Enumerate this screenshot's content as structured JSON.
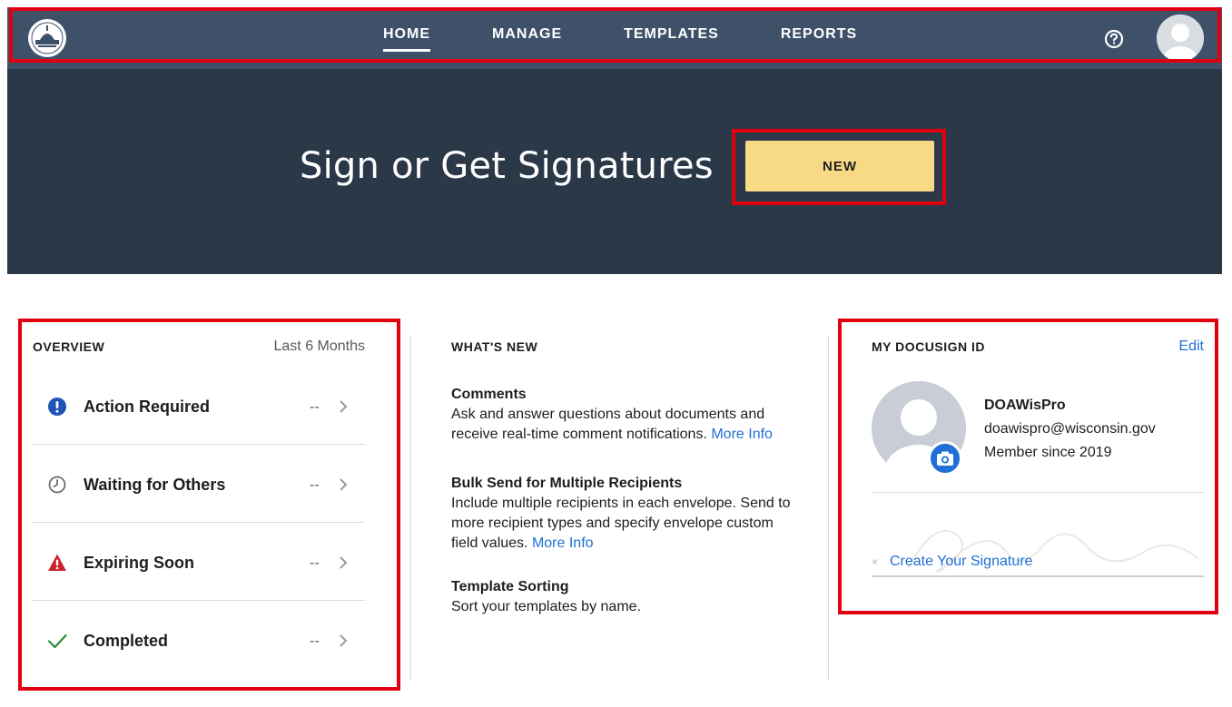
{
  "nav": {
    "tabs": [
      {
        "label": "HOME",
        "active": true
      },
      {
        "label": "MANAGE",
        "active": false
      },
      {
        "label": "TEMPLATES",
        "active": false
      },
      {
        "label": "REPORTS",
        "active": false
      }
    ],
    "help_icon": "help-circle-icon",
    "avatar_icon": "user-avatar-icon",
    "logo_icon": "state-seal-logo"
  },
  "hero": {
    "title": "Sign or Get Signatures",
    "new_button": "NEW"
  },
  "overview": {
    "title": "OVERVIEW",
    "range": "Last 6 Months",
    "rows": [
      {
        "label": "Action Required",
        "count": "--",
        "icon": "exclamation-circle-icon"
      },
      {
        "label": "Waiting for Others",
        "count": "--",
        "icon": "clock-icon"
      },
      {
        "label": "Expiring Soon",
        "count": "--",
        "icon": "warning-triangle-icon"
      },
      {
        "label": "Completed",
        "count": "--",
        "icon": "checkmark-icon"
      }
    ]
  },
  "whats_new": {
    "title": "WHAT'S NEW",
    "items": [
      {
        "title": "Comments",
        "body": "Ask and answer questions about documents and receive real-time comment notifications.",
        "link": "More Info"
      },
      {
        "title": "Bulk Send for Multiple Recipients",
        "body": "Include multiple recipients in each envelope. Send to more recipient types and specify envelope custom field values.",
        "link": "More Info"
      },
      {
        "title": "Template Sorting",
        "body": "Sort your templates by name.",
        "link": ""
      }
    ]
  },
  "docusign_id": {
    "title": "MY DOCUSIGN ID",
    "edit": "Edit",
    "name": "DOAWisPro",
    "email": "doawispro@wisconsin.gov",
    "member_since": "Member since 2019",
    "signature_x": "×",
    "create_signature": "Create Your Signature"
  },
  "colors": {
    "nav_bg": "#3e5169",
    "hero_bg": "#2b3848",
    "new_button_bg": "#f8d985",
    "link": "#1f6fd6",
    "highlight": "#e0000f"
  }
}
